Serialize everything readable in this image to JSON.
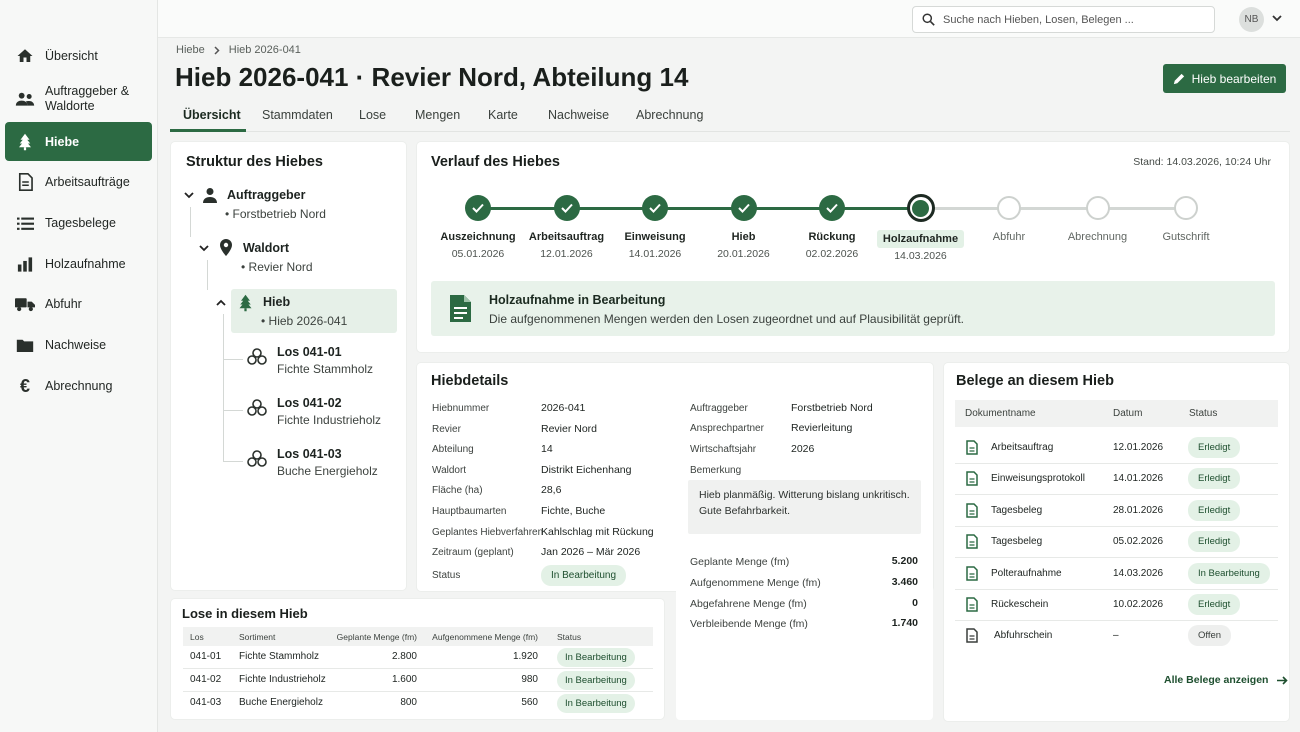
{
  "sidebar": {
    "items": [
      {
        "label": "Übersicht",
        "icon": "home-icon"
      },
      {
        "label": "Auftraggeber & Waldorte",
        "icon": "users-icon"
      },
      {
        "label": "Hiebe",
        "icon": "tree-icon",
        "active": true
      },
      {
        "label": "Arbeitsaufträge",
        "icon": "document-icon"
      },
      {
        "label": "Tagesbelege",
        "icon": "list-icon"
      },
      {
        "label": "Holzaufnahme",
        "icon": "bar-chart-icon"
      },
      {
        "label": "Abfuhr",
        "icon": "truck-icon"
      },
      {
        "label": "Nachweise",
        "icon": "folder-icon"
      },
      {
        "label": "Abrechnung",
        "icon": "euro-icon"
      }
    ]
  },
  "topbar": {
    "search_placeholder": "Suche nach Hieben, Losen, Belegen ...",
    "avatar_initials": "NB"
  },
  "breadcrumb": {
    "parent": "Hiebe",
    "current": "Hieb 2026-041"
  },
  "page_title": "Hieb 2026-041 · Revier Nord, Abteilung 14",
  "edit_button": "Hieb bearbeiten",
  "tabs": [
    "Übersicht",
    "Stammdaten",
    "Lose",
    "Mengen",
    "Karte",
    "Nachweise",
    "Abrechnung"
  ],
  "structure": {
    "title": "Struktur des Hiebes",
    "client": {
      "label": "Auftraggeber",
      "value": "Forstbetrieb Nord"
    },
    "location": {
      "label": "Waldort",
      "value": "Revier Nord"
    },
    "hieb": {
      "label": "Hieb",
      "value": "Hieb 2026-041"
    },
    "lots": [
      {
        "id": "Los 041-01",
        "name": "Fichte Stammholz"
      },
      {
        "id": "Los 041-02",
        "name": "Fichte Industrieholz"
      },
      {
        "id": "Los 041-03",
        "name": "Buche Energieholz"
      }
    ]
  },
  "timeline": {
    "title": "Verlauf des Hiebes",
    "stand": "Stand: 14.03.2026, 10:24 Uhr",
    "steps": [
      {
        "label": "Auszeichnung",
        "date": "05.01.2026",
        "state": "done"
      },
      {
        "label": "Arbeitsauftrag",
        "date": "12.01.2026",
        "state": "done"
      },
      {
        "label": "Einweisung",
        "date": "14.01.2026",
        "state": "done"
      },
      {
        "label": "Hieb",
        "date": "20.01.2026",
        "state": "done"
      },
      {
        "label": "Rückung",
        "date": "02.02.2026",
        "state": "done"
      },
      {
        "label": "Holzaufnahme",
        "date": "14.03.2026",
        "state": "current"
      },
      {
        "label": "Abfuhr",
        "date": "",
        "state": "future"
      },
      {
        "label": "Abrechnung",
        "date": "",
        "state": "future"
      },
      {
        "label": "Gutschrift",
        "date": "",
        "state": "future"
      }
    ],
    "info_title": "Holzaufnahme in Bearbeitung",
    "info_text": "Die aufgenommenen Mengen werden den Losen zugeordnet und auf Plausibilität geprüft."
  },
  "details": {
    "title": "Hiebdetails",
    "left": [
      {
        "k": "Hiebnummer",
        "v": "2026-041"
      },
      {
        "k": "Revier",
        "v": "Revier Nord"
      },
      {
        "k": "Abteilung",
        "v": "14"
      },
      {
        "k": "Waldort",
        "v": "Distrikt Eichenhang"
      },
      {
        "k": "Fläche (ha)",
        "v": "28,6"
      },
      {
        "k": "Hauptbaumarten",
        "v": "Fichte, Buche"
      },
      {
        "k": "Geplantes Hiebverfahren",
        "v": "Kahlschlag mit Rückung"
      },
      {
        "k": "Zeitraum (geplant)",
        "v": "Jan 2026 – Mär 2026"
      }
    ],
    "status_label": "Status",
    "status_value": "In Bearbeitung",
    "right": [
      {
        "k": "Auftraggeber",
        "v": "Forstbetrieb Nord"
      },
      {
        "k": "Ansprechpartner",
        "v": "Revierleitung"
      },
      {
        "k": "Wirtschaftsjahr",
        "v": "2026"
      }
    ],
    "remark_label": "Bemerkung",
    "remark_text": "Hieb planmäßig. Witterung bislang unkritisch. Gute Befahrbarkeit.",
    "quantities": [
      {
        "k": "Geplante Menge (fm)",
        "v": "5.200"
      },
      {
        "k": "Aufgenommene Menge (fm)",
        "v": "3.460"
      },
      {
        "k": "Abgefahrene Menge (fm)",
        "v": "0"
      },
      {
        "k": "Verbleibende Menge (fm)",
        "v": "1.740"
      }
    ]
  },
  "lots_table": {
    "title": "Lose in diesem Hieb",
    "headers": [
      "Los",
      "Sortiment",
      "Geplante Menge (fm)",
      "Aufgenommene Menge (fm)",
      "Status"
    ],
    "rows": [
      [
        "041-01",
        "Fichte Stammholz",
        "2.800",
        "1.920",
        "In Bearbeitung"
      ],
      [
        "041-02",
        "Fichte Industrieholz",
        "1.600",
        "980",
        "In Bearbeitung"
      ],
      [
        "041-03",
        "Buche Energieholz",
        "800",
        "560",
        "In Bearbeitung"
      ]
    ]
  },
  "documents": {
    "title": "Belege an diesem Hieb",
    "headers": [
      "Dokumentname",
      "Datum",
      "Status"
    ],
    "rows": [
      {
        "name": "Arbeitsauftrag",
        "date": "12.01.2026",
        "status": "Erledigt",
        "kind": "green"
      },
      {
        "name": "Einweisungsprotokoll",
        "date": "14.01.2026",
        "status": "Erledigt",
        "kind": "green"
      },
      {
        "name": "Tagesbeleg",
        "date": "28.01.2026",
        "status": "Erledigt",
        "kind": "green"
      },
      {
        "name": "Tagesbeleg",
        "date": "05.02.2026",
        "status": "Erledigt",
        "kind": "green"
      },
      {
        "name": "Polteraufnahme",
        "date": "14.03.2026",
        "status": "In Bearbeitung",
        "kind": "green"
      },
      {
        "name": "Rückeschein",
        "date": "10.02.2026",
        "status": "Erledigt",
        "kind": "green"
      },
      {
        "name": "Abfuhrschein",
        "date": "–",
        "status": "Offen",
        "kind": "grey"
      }
    ],
    "all_link": "Alle Belege anzeigen"
  },
  "colors": {
    "primary": "#2c6a43",
    "badge_bg": "#e3f1e6",
    "info_bg": "#e8f2ea"
  }
}
